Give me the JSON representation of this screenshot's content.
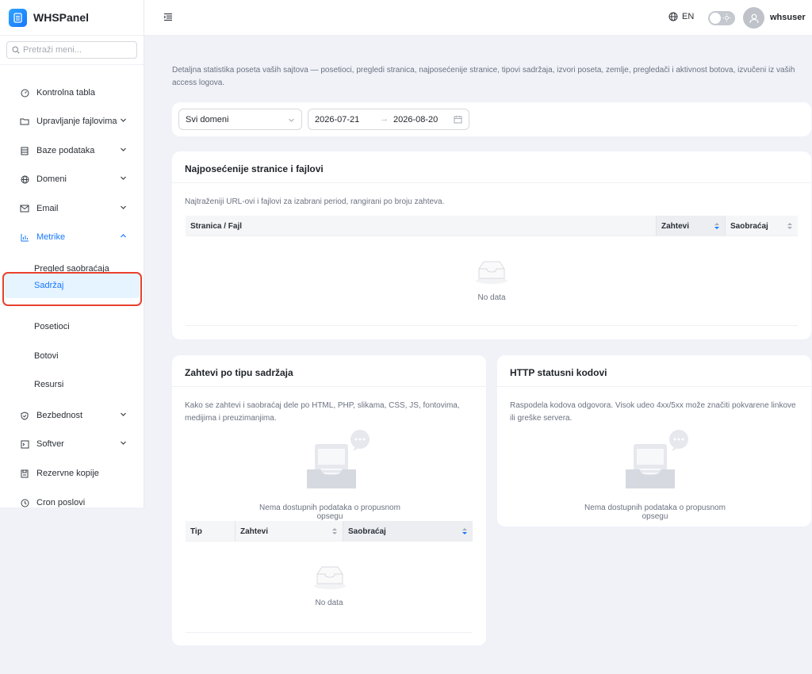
{
  "app": {
    "name": "WHSPanel"
  },
  "sidebar": {
    "search_placeholder": "Pretraži meni...",
    "items": [
      {
        "label": "Kontrolna tabla",
        "icon": "dashboard-icon"
      },
      {
        "label": "Upravljanje fajlovima",
        "icon": "folder-icon"
      },
      {
        "label": "Baze podataka",
        "icon": "database-icon"
      },
      {
        "label": "Domeni",
        "icon": "globe-icon"
      },
      {
        "label": "Email",
        "icon": "mail-icon"
      },
      {
        "label": "Metrike",
        "icon": "chart-icon"
      }
    ],
    "metrike_sub": [
      {
        "label": "Pregled saobraćaja"
      },
      {
        "label": "Sadržaj"
      },
      {
        "label": "Posetioci"
      },
      {
        "label": "Botovi"
      },
      {
        "label": "Resursi"
      }
    ],
    "items_after": [
      {
        "label": "Bezbednost",
        "icon": "shield-icon"
      },
      {
        "label": "Softver",
        "icon": "software-icon"
      },
      {
        "label": "Rezervne kopije",
        "icon": "backup-icon"
      },
      {
        "label": "Cron poslovi",
        "icon": "clock-icon"
      }
    ]
  },
  "header": {
    "language": "EN",
    "username": "whsuser"
  },
  "page": {
    "intro": "Detaljna statistika poseta vaših sajtova — posetioci, pregledi stranica, najposećenije stranice, tipovi sadržaja, izvori poseta, zemlje, pregledači i aktivnost botova, izvučeni iz vaših access logova."
  },
  "filters": {
    "domain_value": "Svi domeni",
    "date_from": "2026-07-21",
    "date_to": "2026-08-20",
    "range_sep": "→"
  },
  "top_pages": {
    "title": "Najposećenije stranice i fajlovi",
    "description": "Najtraženiji URL-ovi i fajlovi za izabrani period, rangirani po broju zahteva.",
    "columns": [
      "Stranica / Fajl",
      "Zahtevi",
      "Saobraćaj"
    ],
    "empty_text": "No data"
  },
  "content_types": {
    "title": "Zahtevi po tipu sadržaja",
    "description": "Kako se zahtevi i saobraćaj dele po HTML, PHP, slikama, CSS, JS, fontovima, medijima i preuzimanjima.",
    "empty_chart_text": "Nema dostupnih podataka o propusnom opsegu",
    "columns": [
      "Tip",
      "Zahtevi",
      "Saobraćaj"
    ],
    "empty_text": "No data"
  },
  "http_status": {
    "title": "HTTP statusni kodovi",
    "description": "Raspodela kodova odgovora. Visok udeo 4xx/5xx može značiti pokvarene linkove ili greške servera.",
    "empty_chart_text": "Nema dostupnih podataka o propusnom opsegu"
  },
  "colors": {
    "accent": "#1677ff",
    "active_bg": "#e6f4ff",
    "highlight": "#e8412c",
    "page_bg": "#f0f2f8"
  }
}
